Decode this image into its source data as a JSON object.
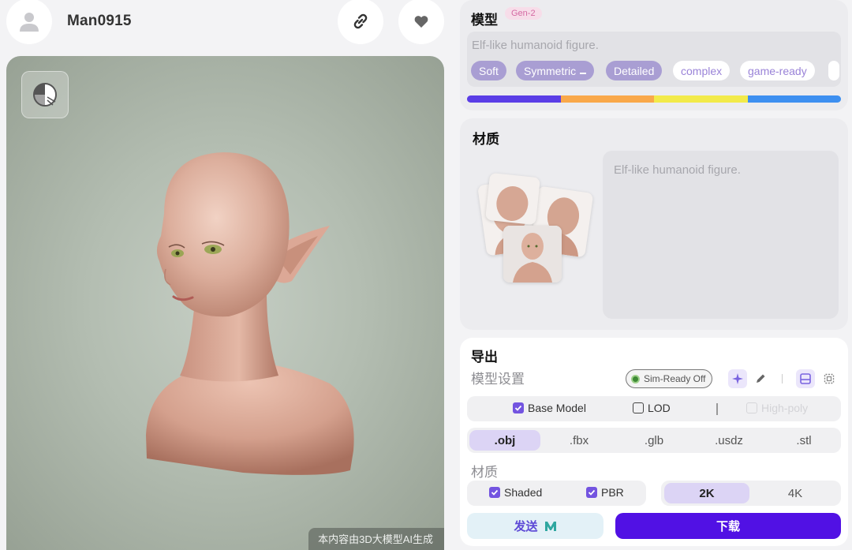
{
  "header": {
    "username": "Man0915",
    "icons": {
      "avatar": "user-icon",
      "share": "link-icon",
      "like": "heart-icon"
    }
  },
  "viewer": {
    "watermark": "本内容由3D大模型AI生成",
    "toggle_icon": "shading-toggle-icon",
    "background_color": "#b7c1b5"
  },
  "model_card": {
    "title": "模型",
    "badge": "Gen-2",
    "prompt": "Elf-like humanoid figure.",
    "tags": [
      {
        "label": "Soft",
        "selected": true
      },
      {
        "label": "Symmetric",
        "selected": true
      },
      {
        "label": "Detailed",
        "selected": true
      },
      {
        "label": "complex",
        "selected": false
      },
      {
        "label": "game-ready",
        "selected": false
      }
    ],
    "color_bar": [
      "#5a3de6",
      "#f9a84a",
      "#f2ea4a",
      "#3d8ff0"
    ]
  },
  "material_card": {
    "title": "材质",
    "description": "Elf-like humanoid figure."
  },
  "export_card": {
    "title": "导出",
    "model_settings_label": "模型设置",
    "sim_ready": "Sim-Ready Off",
    "tool_icons": [
      "sparkle-icon",
      "pencil-icon",
      "texture-icon",
      "wireframe-icon"
    ],
    "model_options": [
      {
        "label": "Base Model",
        "state": "checked"
      },
      {
        "label": "LOD",
        "state": "unchecked"
      },
      {
        "label": "High-poly",
        "state": "disabled"
      }
    ],
    "formats": [
      {
        "label": ".obj",
        "selected": true
      },
      {
        "label": ".fbx",
        "selected": false
      },
      {
        "label": ".glb",
        "selected": false
      },
      {
        "label": ".usdz",
        "selected": false
      },
      {
        "label": ".stl",
        "selected": false
      }
    ],
    "material_label": "材质",
    "material_options": [
      {
        "label": "Shaded",
        "state": "checked"
      },
      {
        "label": "PBR",
        "state": "checked"
      }
    ],
    "resolutions": [
      {
        "label": "2K",
        "selected": true
      },
      {
        "label": "4K",
        "selected": false
      }
    ],
    "send_label": "发送",
    "download_label": "下载",
    "accent_color": "#5111e4"
  }
}
